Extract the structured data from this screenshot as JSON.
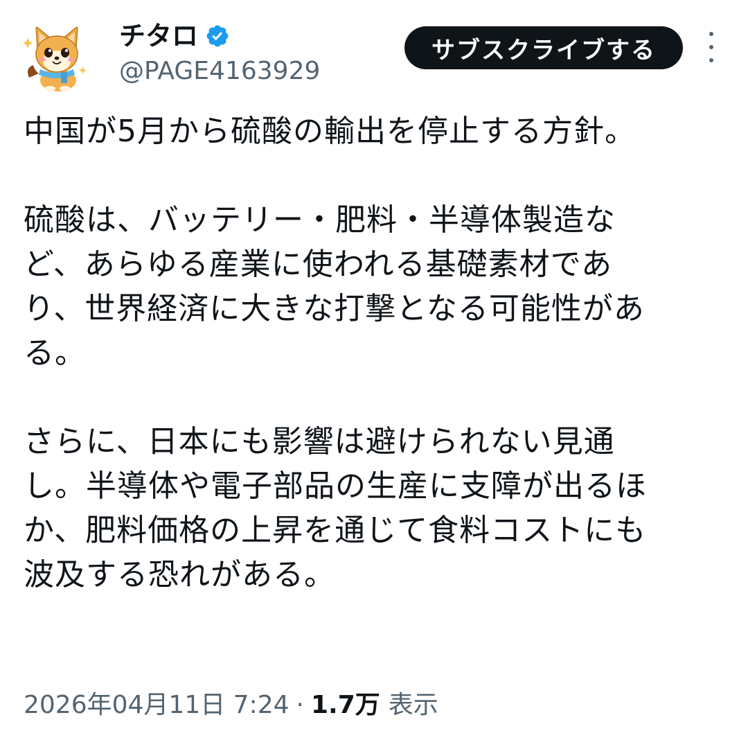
{
  "user": {
    "display_name": "チタロ",
    "handle": "@PAGE4163929",
    "verified": true,
    "avatar_icon": "cartoon-dog-avatar-icon"
  },
  "actions": {
    "subscribe_label": "サブスクライブする",
    "more_icon": "vertical-ellipsis-icon"
  },
  "tweet": {
    "paragraphs": [
      [
        "中国が5月から硫酸の輸出を停止する方針。"
      ],
      [
        "硫酸は、バッテリー・肥料・半導体製造な",
        "ど、あらゆる産業に使われる基礎素材であ",
        "り、世界経済に大きな打撃となる可能性があ",
        "る。"
      ],
      [
        "さらに、日本にも影響は避けられない見通",
        "し。半導体や電子部品の生産に支障が出るほ",
        "か、肥料価格の上昇を通じて食料コストにも",
        "波及する恐れがある。"
      ]
    ]
  },
  "meta": {
    "timestamp": "2026年04月11日 7:24",
    "separator": "·",
    "views_count": "1.7万",
    "views_label": "表示"
  },
  "colors": {
    "text": "#0f1419",
    "secondary": "#536471",
    "verified_badge": "#1d9bf0",
    "button_bg": "#0f1419"
  }
}
